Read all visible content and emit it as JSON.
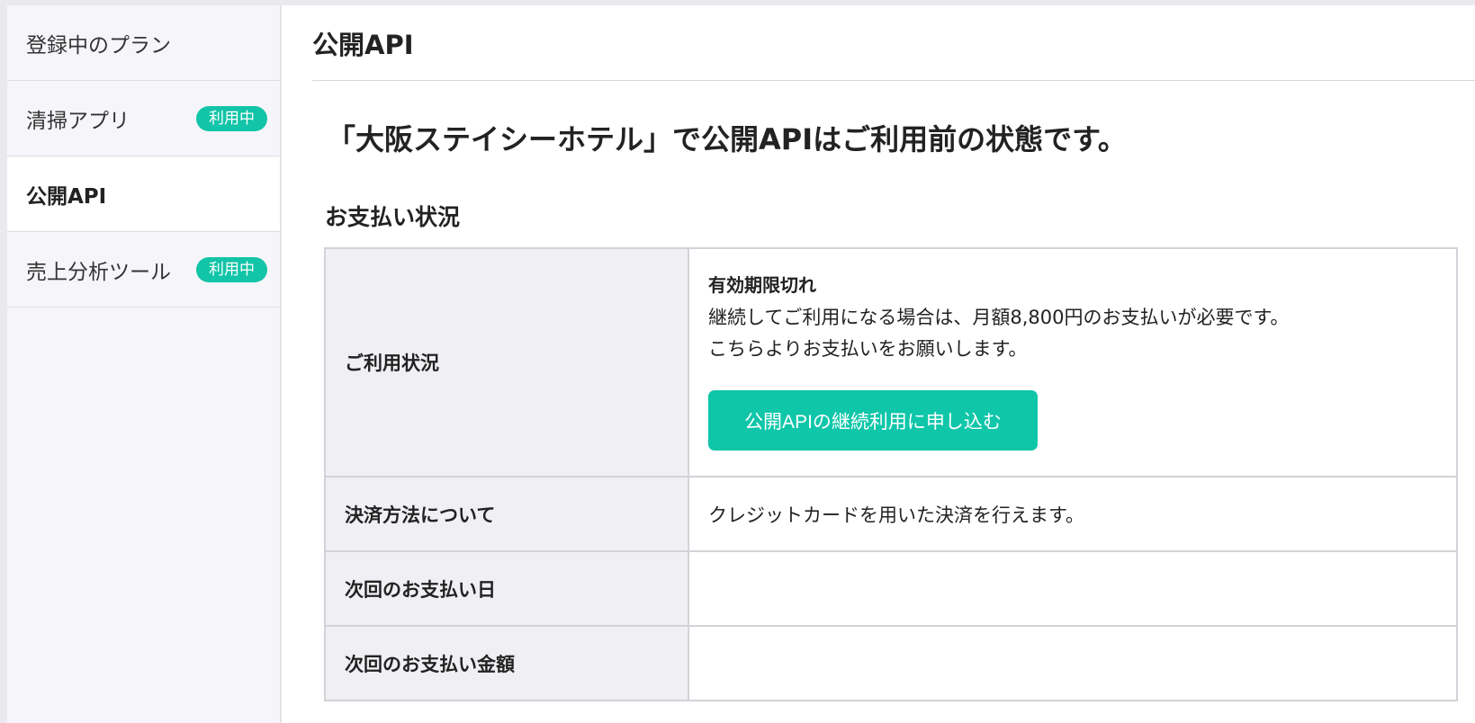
{
  "sidebar": {
    "items": [
      {
        "label": "登録中のプラン",
        "badge": ""
      },
      {
        "label": "清掃アプリ",
        "badge": "利用中"
      },
      {
        "label": "公開API",
        "badge": "",
        "active": true
      },
      {
        "label": "売上分析ツール",
        "badge": "利用中"
      }
    ]
  },
  "header": {
    "title": "公開API"
  },
  "main": {
    "status_headline": "「大阪ステイシーホテル」で公開APIはご利用前の状態です。",
    "payment_section_title": "お支払い状況",
    "table": {
      "usage_label": "ご利用状況",
      "usage_status": "有効期限切れ",
      "usage_line1": "継続してご利用になる場合は、月額8,800円のお支払いが必要です。",
      "usage_line2": "こちらよりお支払いをお願いします。",
      "apply_button": "公開APIの継続利用に申し込む",
      "method_label": "決済方法について",
      "method_value": "クレジットカードを用いた決済を行えます。",
      "next_date_label": "次回のお支払い日",
      "next_date_value": "",
      "next_amount_label": "次回のお支払い金額",
      "next_amount_value": ""
    }
  },
  "colors": {
    "accent": "#0fc6a9",
    "sidebar_bg": "#f6f6fa",
    "label_bg": "#f0f0f4"
  }
}
